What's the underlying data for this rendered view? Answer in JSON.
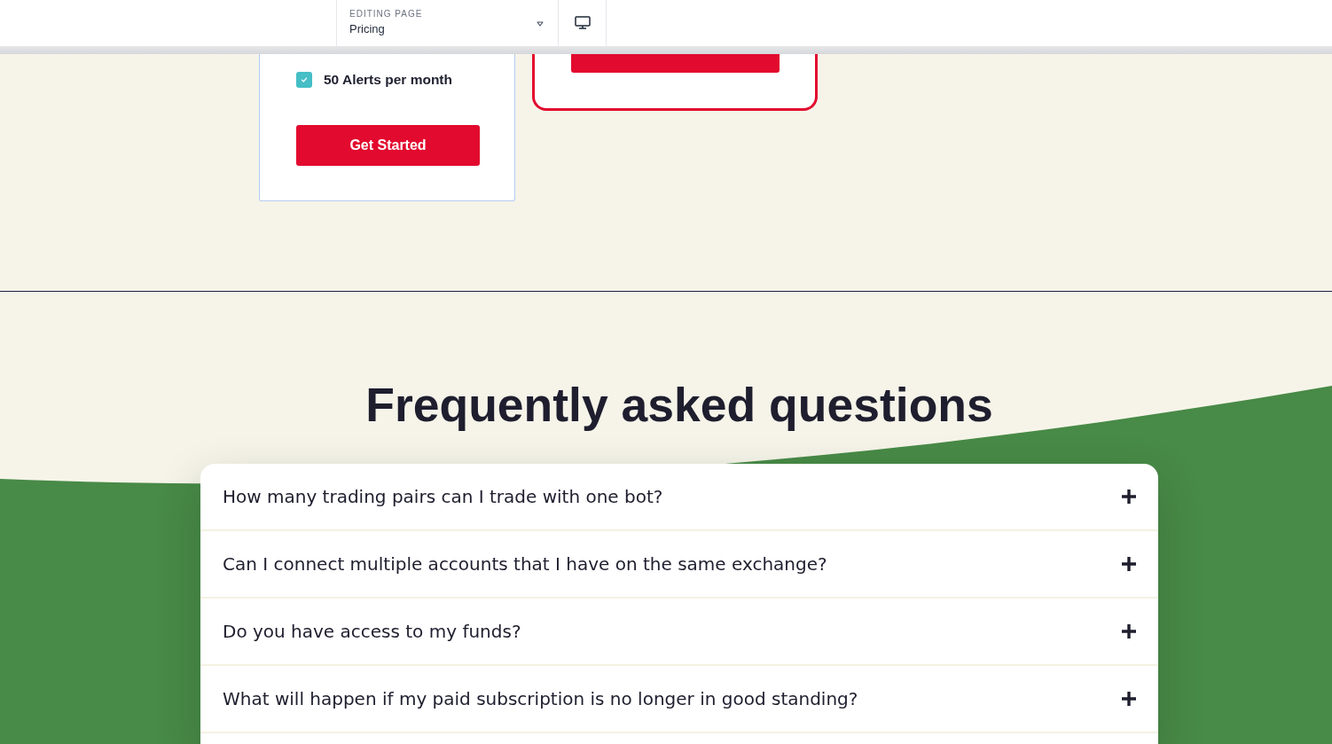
{
  "toolbar": {
    "page_selector": {
      "label": "EDITING PAGE",
      "value": "Pricing"
    }
  },
  "pricing_cards": [
    {
      "kind": "standard",
      "selected": true,
      "features": [
        {
          "label": "50 Alerts per month",
          "checked": true
        }
      ],
      "button": "Get Started"
    },
    {
      "kind": "featured",
      "selected": false
    }
  ],
  "faq": {
    "title": "Frequently asked questions",
    "items": [
      {
        "question": "How many trading pairs can I trade with one bot?",
        "expanded": false
      },
      {
        "question": "Can I connect multiple accounts that I have on the same exchange?",
        "expanded": false
      },
      {
        "question": "Do you have access to my funds?",
        "expanded": false
      },
      {
        "question": "What will happen if my paid subscription is no longer in good standing?",
        "expanded": false
      }
    ]
  }
}
